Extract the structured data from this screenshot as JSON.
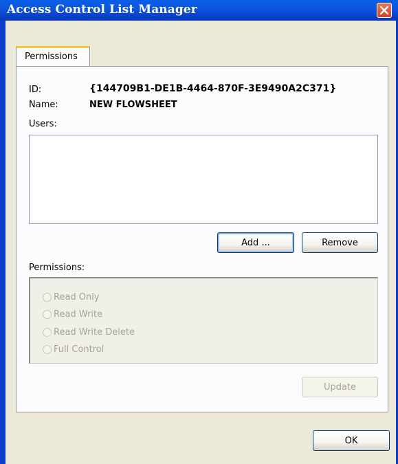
{
  "window": {
    "title": "Access Control List Manager",
    "close_icon": "close-icon"
  },
  "tabs": [
    {
      "label": "Permissions",
      "active": true
    }
  ],
  "info": {
    "id_label": "ID:",
    "id_value": "{144709B1-DE1B-4464-870F-3E9490A2C371}",
    "name_label": "Name:",
    "name_value": "NEW FLOWSHEET"
  },
  "users": {
    "label": "Users:",
    "items": [],
    "add_label": "Add ...",
    "remove_label": "Remove"
  },
  "permissions": {
    "label": "Permissions:",
    "options": [
      {
        "label": "Read Only",
        "enabled": false,
        "selected": false
      },
      {
        "label": "Read Write",
        "enabled": false,
        "selected": false
      },
      {
        "label": "Read Write Delete",
        "enabled": false,
        "selected": false
      },
      {
        "label": "Full Control",
        "enabled": false,
        "selected": false
      }
    ],
    "update_label": "Update"
  },
  "footer": {
    "ok_label": "OK"
  },
  "colors": {
    "titlebar": "#0a4fd8",
    "face": "#ece9d8",
    "tab_highlight": "#ffc83c",
    "close_button": "#d9583a"
  }
}
